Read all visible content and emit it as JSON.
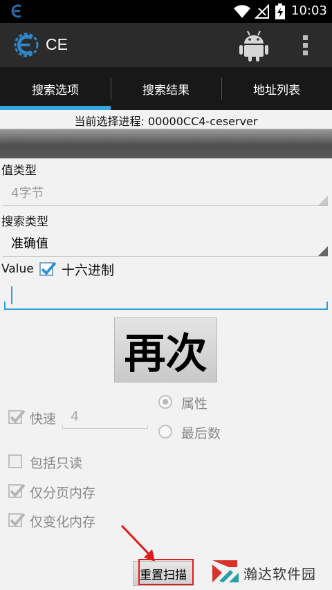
{
  "status_bar": {
    "time": "10:03"
  },
  "action_bar": {
    "title": "CE"
  },
  "tabs": [
    {
      "label": "搜索选项",
      "active": true
    },
    {
      "label": "搜索结果",
      "active": false
    },
    {
      "label": "地址列表",
      "active": false
    }
  ],
  "process": {
    "text": "当前选择进程: 00000CC4-ceserver"
  },
  "value_type": {
    "label": "值类型",
    "selected": "4字节"
  },
  "search_type": {
    "label": "搜索类型",
    "selected": "准确值"
  },
  "value": {
    "label": "Value",
    "hex_label": "十六进制",
    "hex_checked": true,
    "input_value": ""
  },
  "again_button": {
    "label": "再次"
  },
  "options": {
    "fast_label": "快速",
    "fast_checked": true,
    "fast_value": "4",
    "radio_attribute": "属性",
    "radio_last_digits": "最后数",
    "include_readonly": "包括只读",
    "readonly_checked": false,
    "paged_only": "仅分页内存",
    "paged_checked": true,
    "changed_only": "仅变化内存",
    "changed_checked": true
  },
  "reset_button": {
    "label": "重置扫描"
  },
  "watermark": {
    "text": "瀚达软件园"
  },
  "colors": {
    "accent": "#33a7de",
    "highlight": "#e01b1b",
    "action_bar": "#2b2b2b"
  }
}
